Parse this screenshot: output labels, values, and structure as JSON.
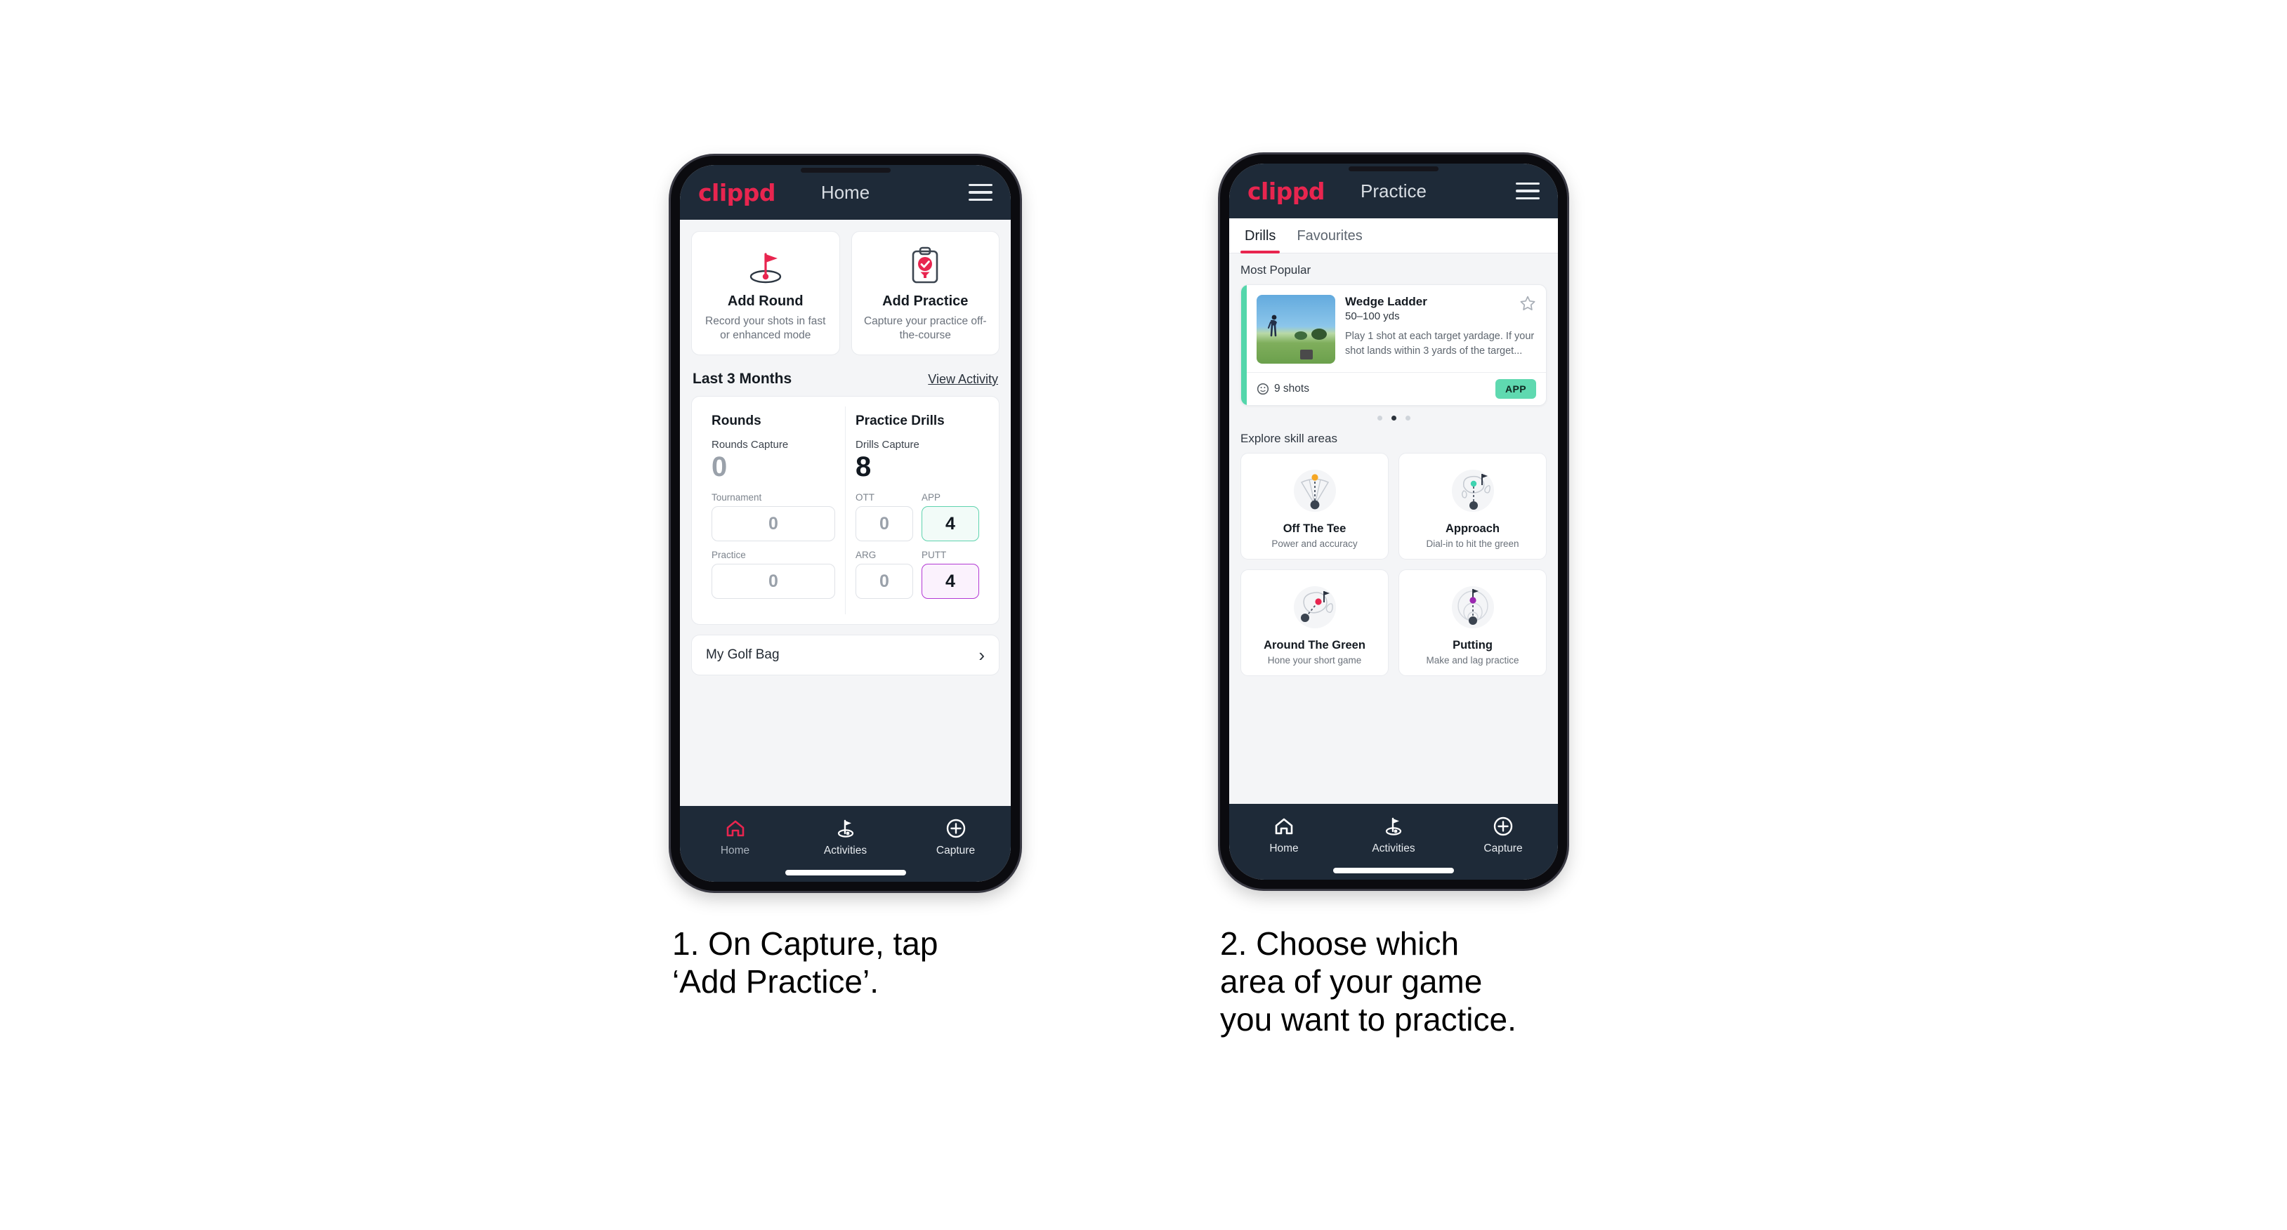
{
  "brand": "clippd",
  "phone1": {
    "appbar": {
      "title": "Home",
      "menu_icon": "hamburger-menu-icon"
    },
    "quick_actions": [
      {
        "icon": "golf-flag-hole-icon",
        "title": "Add Round",
        "subtitle": "Record your shots in fast or enhanced mode"
      },
      {
        "icon": "clipboard-check-tee-icon",
        "title": "Add Practice",
        "subtitle": "Capture your practice off-the-course"
      }
    ],
    "section": {
      "title": "Last 3 Months",
      "link": "View Activity"
    },
    "stats": {
      "rounds": {
        "heading": "Rounds",
        "capture_label": "Rounds Capture",
        "capture_value": "0",
        "fields": [
          {
            "label": "Tournament",
            "value": "0",
            "state": "default"
          },
          {
            "label": "Practice",
            "value": "0",
            "state": "default"
          }
        ]
      },
      "practice_drills": {
        "heading": "Practice Drills",
        "capture_label": "Drills Capture",
        "capture_value": "8",
        "fields": [
          {
            "label": "OTT",
            "value": "0",
            "state": "default"
          },
          {
            "label": "APP",
            "value": "4",
            "state": "green"
          },
          {
            "label": "ARG",
            "value": "0",
            "state": "default"
          },
          {
            "label": "PUTT",
            "value": "4",
            "state": "purple"
          }
        ]
      }
    },
    "golf_bag": {
      "label": "My Golf Bag",
      "chevron": "chevron-right-icon"
    },
    "bottom_nav": [
      {
        "label": "Home",
        "icon": "home-icon",
        "active": true
      },
      {
        "label": "Activities",
        "icon": "golf-flag-icon",
        "active": false
      },
      {
        "label": "Capture",
        "icon": "plus-circle-icon",
        "active": false
      }
    ]
  },
  "phone2": {
    "appbar": {
      "title": "Practice",
      "menu_icon": "hamburger-menu-icon"
    },
    "tabs": [
      {
        "label": "Drills",
        "active": true
      },
      {
        "label": "Favourites",
        "active": false
      }
    ],
    "most_popular_label": "Most Popular",
    "drill": {
      "name": "Wedge Ladder",
      "distance": "50–100 yds",
      "description": "Play 1 shot at each target yardage. If your shot lands within 3 yards of the target...",
      "shots": "9 shots",
      "badge": "APP",
      "star_icon": "star-outline-icon",
      "clock_icon": "clock-icon",
      "accent_color": "#54d6ab",
      "next_card_accent": "#a32fd1",
      "thumbnail": "golfer-on-range-photo"
    },
    "carousel_dots": {
      "count": 3,
      "active_index": 1
    },
    "explore_label": "Explore skill areas",
    "skill_areas": [
      {
        "title": "Off The Tee",
        "subtitle": "Power and accuracy",
        "icon": "tee-shot-dispersion-icon",
        "dot_color": "#f5a623"
      },
      {
        "title": "Approach",
        "subtitle": "Dial-in to hit the green",
        "icon": "approach-green-icon",
        "dot_color": "#3fd3b0"
      },
      {
        "title": "Around The Green",
        "subtitle": "Hone your short game",
        "icon": "chip-around-green-icon",
        "dot_color": "#e8254f"
      },
      {
        "title": "Putting",
        "subtitle": "Make and lag practice",
        "icon": "putting-rings-icon",
        "dot_color": "#9b27b0"
      }
    ],
    "bottom_nav": [
      {
        "label": "Home",
        "icon": "home-icon",
        "active": false
      },
      {
        "label": "Activities",
        "icon": "golf-flag-icon",
        "active": true
      },
      {
        "label": "Capture",
        "icon": "plus-circle-icon",
        "active": false
      }
    ]
  },
  "captions": {
    "step1": "1. On Capture, tap\n‘Add Practice’.",
    "step2": "2. Choose which\narea of your game\nyou want to practice."
  },
  "colors": {
    "brand_pink": "#e8254f",
    "appbar_dark": "#1e2a38",
    "mint": "#54d6ab",
    "purple": "#a32fd1",
    "page_bg": "#f4f5f7"
  }
}
